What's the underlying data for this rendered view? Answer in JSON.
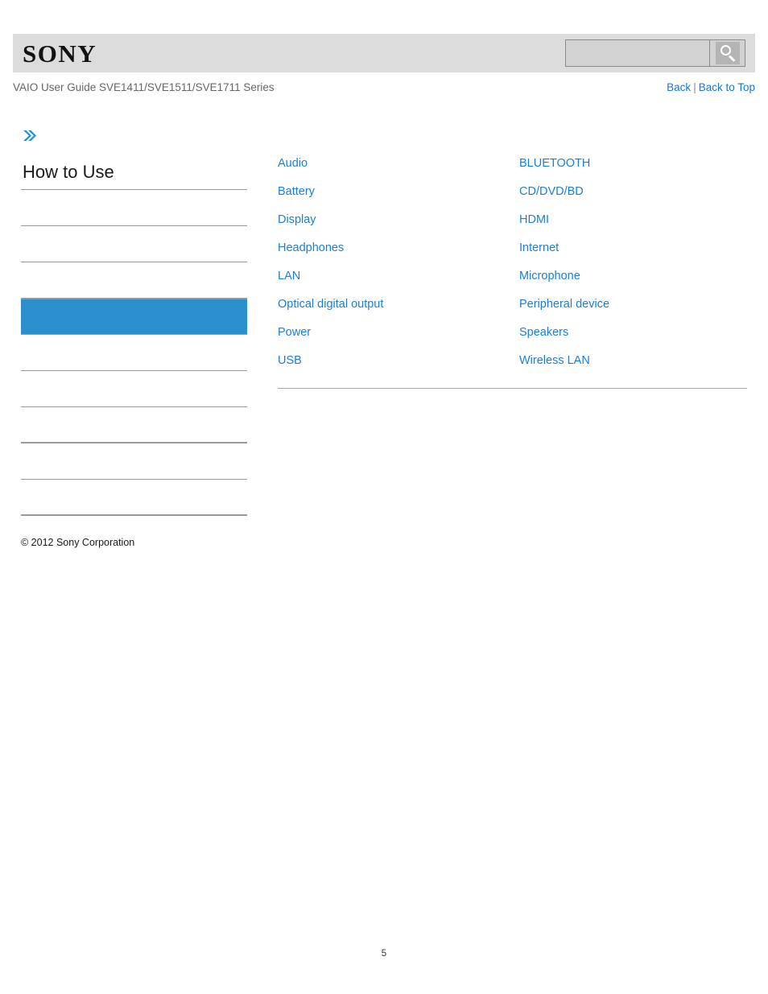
{
  "header": {
    "logo_text": "SONY",
    "logo_icon": "sony-logo",
    "search": {
      "value": "",
      "placeholder": "",
      "button_icon": "search-icon"
    }
  },
  "title_row": {
    "guide_title": "VAIO User Guide SVE1411/SVE1511/SVE1711 Series",
    "nav": {
      "back_label": "Back",
      "separator": "|",
      "back_to_top_label": "Back to Top"
    }
  },
  "sidebar": {
    "chevron_icon": "double-chevron-right-icon",
    "heading": "How to Use",
    "items": [
      {
        "label": "",
        "active": false,
        "thick": false
      },
      {
        "label": "",
        "active": false,
        "thick": false
      },
      {
        "label": "",
        "active": false,
        "thick": false
      },
      {
        "label": "",
        "active": true,
        "thick": false
      },
      {
        "label": "",
        "active": false,
        "thick": false
      },
      {
        "label": "",
        "active": false,
        "thick": false
      },
      {
        "label": "",
        "active": false,
        "thick": true
      },
      {
        "label": "",
        "active": false,
        "thick": false
      },
      {
        "label": "",
        "active": false,
        "thick": true
      }
    ],
    "copyright": "© 2012 Sony Corporation"
  },
  "main": {
    "columns": [
      {
        "links": [
          "Audio",
          "Battery",
          "Display",
          "Headphones",
          "LAN",
          "Optical digital output",
          "Power",
          "USB"
        ]
      },
      {
        "links": [
          "BLUETOOTH",
          "CD/DVD/BD",
          "HDMI",
          "Internet",
          "Microphone",
          "Peripheral device",
          "Speakers",
          "Wireless LAN"
        ]
      }
    ]
  },
  "footer": {
    "page_number": "5"
  },
  "colors": {
    "link_blue": "#1a7fd4",
    "nav_blue": "#1877cf",
    "active_item": "#2b8fcc",
    "header_bar": "#dcdcdc",
    "title_gray": "#666666",
    "rule_gray": "#999999"
  }
}
